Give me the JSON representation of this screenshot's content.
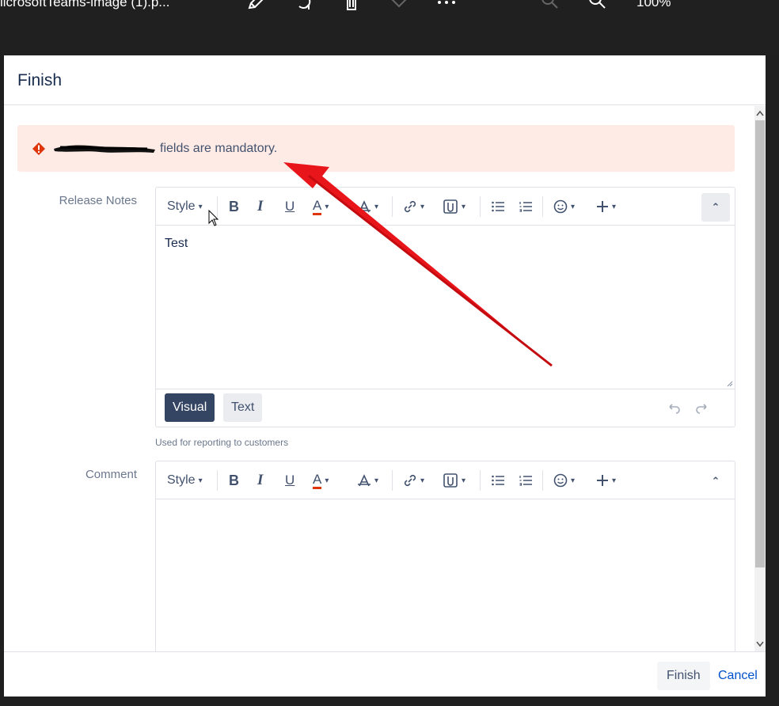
{
  "viewer": {
    "file_title": "licrosoftTeams-image (1).p...",
    "zoom_level": "100%",
    "icons": [
      "edit-icon",
      "rotate-icon",
      "delete-icon",
      "favorite-icon",
      "more-icon",
      "zoom-out-icon",
      "zoom-in-icon"
    ]
  },
  "dialog": {
    "title": "Finish",
    "error": {
      "message": "fields are mandatory."
    },
    "release_notes": {
      "label": "Release Notes",
      "helper": "Used for reporting to customers",
      "content": "Test",
      "toolbar": {
        "style_label": "Style",
        "bold": "B",
        "italic": "I",
        "underline": "U",
        "text_color": "A"
      },
      "modes": {
        "visual": "Visual",
        "text": "Text"
      }
    },
    "comment": {
      "label": "Comment",
      "content": "",
      "toolbar": {
        "style_label": "Style",
        "bold": "B",
        "italic": "I",
        "underline": "U",
        "text_color": "A"
      }
    },
    "footer": {
      "finish_label": "Finish",
      "cancel_label": "Cancel"
    }
  },
  "colors": {
    "error_bg": "#ffebe6",
    "error_icon": "#de350b",
    "visual_active": "#344563",
    "link": "#0052cc",
    "annotation_arrow": "#e8151b"
  }
}
